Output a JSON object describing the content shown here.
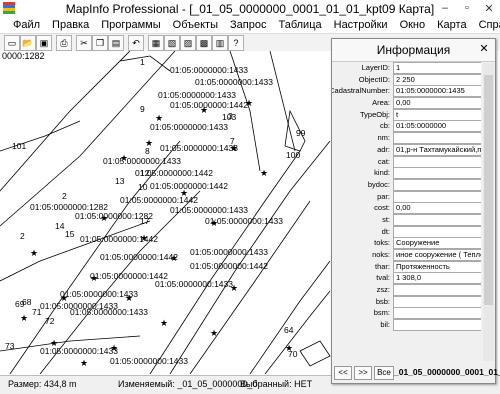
{
  "window": {
    "title": "MapInfo Professional - [_01_05_0000000_0001_01_01_kpt09 Карта]"
  },
  "window_buttons": {
    "minimize": "–",
    "maximize": "▫",
    "close": "✕"
  },
  "menu": [
    "Файл",
    "Правка",
    "Программы",
    "Объекты",
    "Запрос",
    "Таблица",
    "Настройки",
    "Окно",
    "Карта",
    "Справка"
  ],
  "map": {
    "header": "0000:1282",
    "labels": [
      "01:05:0000000:1433",
      "01:05:0000000:1433",
      "01:05:0000000:1433",
      "01:05:0000000:1442",
      "01:05:0000000:1433",
      "01:05:0000000:1433",
      "01:05:0000000:1433",
      "01:05:0000000:1442",
      "01:05:0000000:1442",
      "01:05:0000000:1433",
      "01:05:0000000:1442",
      "01:05:0000000:1282",
      "01:05:0000000:1282",
      "01:05:0000000:1433",
      "01:05:0000000:1442",
      "01:05:0000000:1433",
      "01:05:0000000:1442",
      "01:05:0000000:1442",
      "01:05:0000000:1442",
      "01:05:0000000:1433",
      "01:05:0000000:1433",
      "01:05:0000000:1433",
      "01:05:0000000:1433",
      "01:05:0000000:1433",
      "01:05:0000000:1433",
      "1",
      "3",
      "9",
      "101",
      "100",
      "99",
      "103",
      "12",
      "10",
      "13",
      "2",
      "14",
      "15",
      "17",
      "8",
      "7",
      "72",
      "73",
      "68",
      "69",
      "64",
      "70",
      "71",
      "2"
    ]
  },
  "status": {
    "size": "Размер: 434,8 m",
    "editable": "Изменяемый: _01_05_0000000_0",
    "selected": "Выбранный: НЕТ"
  },
  "info": {
    "title": "Информация",
    "close": "✕",
    "rows": [
      {
        "label": "LayerID:",
        "value": "1"
      },
      {
        "label": "ObjectID:",
        "value": "2 250"
      },
      {
        "label": "CadastralNumber:",
        "value": "01:05:0000000:1435"
      },
      {
        "label": "Area:",
        "value": "0,00"
      },
      {
        "label": "TypeObj:",
        "value": "t"
      },
      {
        "label": "cb:",
        "value": "01:05:0000000"
      },
      {
        "label": "nm:",
        "value": ""
      },
      {
        "label": "adr:",
        "value": "01,р-н Тахтамукайский,п"
      },
      {
        "label": "cat:",
        "value": ""
      },
      {
        "label": "kind:",
        "value": ""
      },
      {
        "label": "bydoc:",
        "value": ""
      },
      {
        "label": "par:",
        "value": ""
      },
      {
        "label": "cost:",
        "value": "0,00"
      },
      {
        "label": "st:",
        "value": ""
      },
      {
        "label": "dt:",
        "value": ""
      },
      {
        "label": "toks:",
        "value": "Сооружение"
      },
      {
        "label": "noks:",
        "value": "иное сооружение ( Тепло"
      },
      {
        "label": "thar:",
        "value": "Протяженность"
      },
      {
        "label": "tval:",
        "value": "1 308,0"
      },
      {
        "label": "zsz:",
        "value": ""
      },
      {
        "label": "bsb:",
        "value": ""
      },
      {
        "label": "bsm:",
        "value": ""
      },
      {
        "label": "bil:",
        "value": ""
      }
    ],
    "nav": {
      "prev": "<<",
      "next": ">>",
      "all": "Все",
      "layer": "_01_05_0000000_0001_01_01_"
    }
  }
}
